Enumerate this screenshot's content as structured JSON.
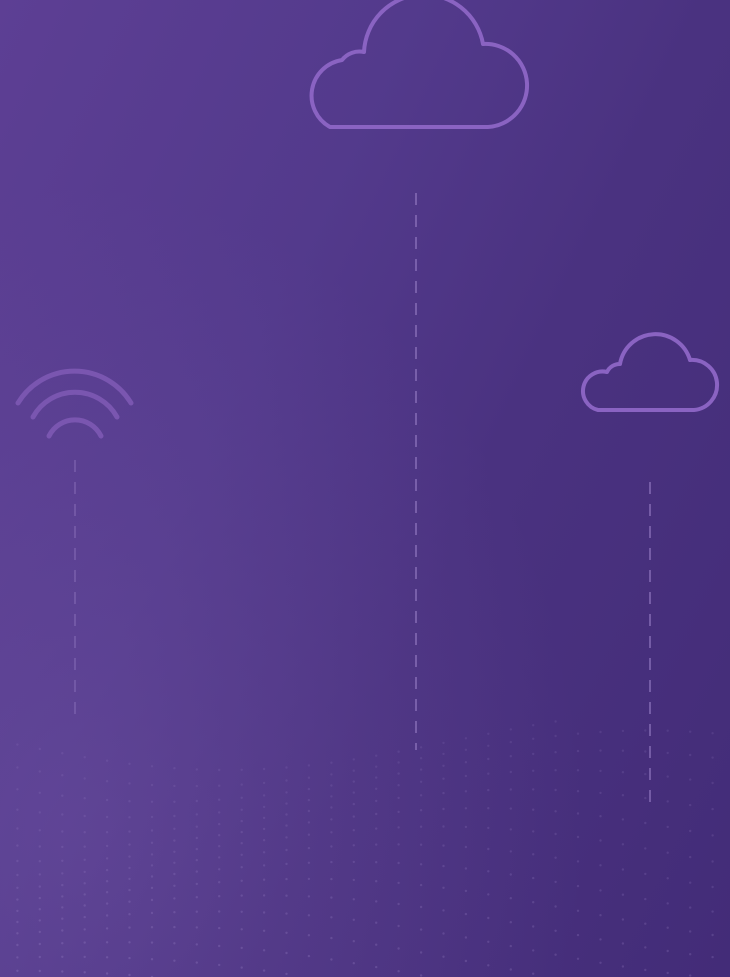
{
  "colors": {
    "background_start": "#5d3f94",
    "background_end": "#432c78",
    "icon_stroke": "#8a63c2",
    "dash_line": "#9b82c9",
    "mesh_dot": "#b39ddb"
  },
  "icons": [
    "cloud-icon",
    "wifi-icon",
    "cloud-icon"
  ],
  "decor": {
    "mesh": "wavy-dot-grid"
  }
}
